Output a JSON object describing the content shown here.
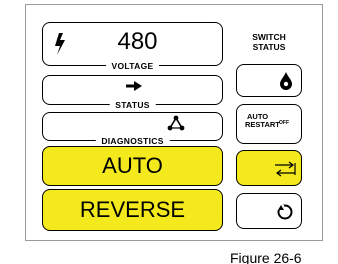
{
  "voltage": {
    "value": "480",
    "legend": "VOLTAGE",
    "icon": "lightning-bolt-icon"
  },
  "status": {
    "legend": "STATUS",
    "icon": "right-arrow-icon"
  },
  "diagnostics": {
    "legend": "DIAGNOSTICS",
    "icon": "diagnostics-triangle-icon"
  },
  "mode_buttons": {
    "auto_label": "AUTO",
    "reverse_label": "REVERSE"
  },
  "switch_status": {
    "title_line1": "SWITCH",
    "title_line2": "STATUS",
    "auto_restart_line1": "AUTO",
    "auto_restart_line2": "RESTART",
    "auto_restart_state": "OFF",
    "icons": [
      "drop-icon",
      "transfer-arrows-icon",
      "cycle-icon"
    ]
  },
  "caption": "Figure 26-6",
  "colors": {
    "highlight": "#f3e91d",
    "border": "#000000",
    "panel_border": "#9a9a9a"
  }
}
